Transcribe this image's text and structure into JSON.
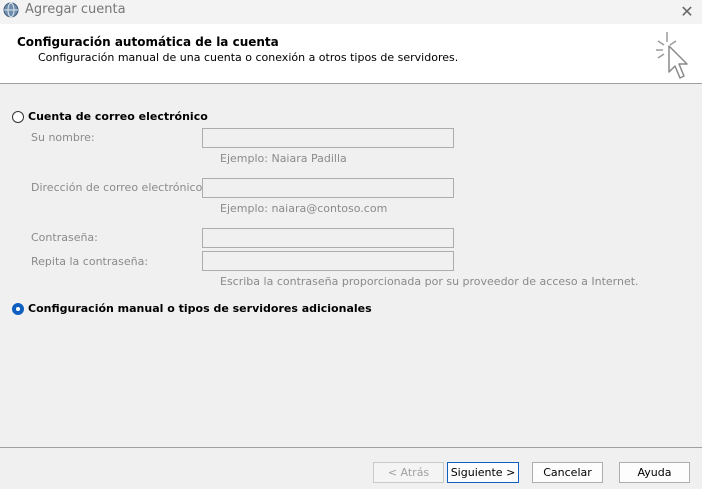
{
  "window": {
    "title": "Agregar cuenta",
    "close_glyph": "✕"
  },
  "header": {
    "title": "Configuración automática de la cuenta",
    "subtitle": "Configuración manual de una cuenta o conexión a otros tipos de servidores."
  },
  "options": {
    "email_account": {
      "label": "Cuenta de correo electrónico",
      "selected": false
    },
    "manual": {
      "label": "Configuración manual o tipos de servidores adicionales",
      "selected": true
    }
  },
  "form": {
    "name": {
      "label": "Su nombre:",
      "value": "",
      "hint": "Ejemplo: Naiara Padilla"
    },
    "email": {
      "label": "Dirección de correo electrónico:",
      "value": "",
      "hint": "Ejemplo: naiara@contoso.com"
    },
    "password": {
      "label": "Contraseña:",
      "value": ""
    },
    "password_repeat": {
      "label": "Repita la contraseña:",
      "value": ""
    },
    "password_hint": "Escriba la contraseña proporcionada por su proveedor de acceso a Internet."
  },
  "buttons": {
    "back": "< Atrás",
    "next": "Siguiente >",
    "cancel": "Cancelar",
    "help": "Ayuda"
  },
  "colors": {
    "accent": "#0f5fc0",
    "disabled_text": "#8a8a8a"
  }
}
